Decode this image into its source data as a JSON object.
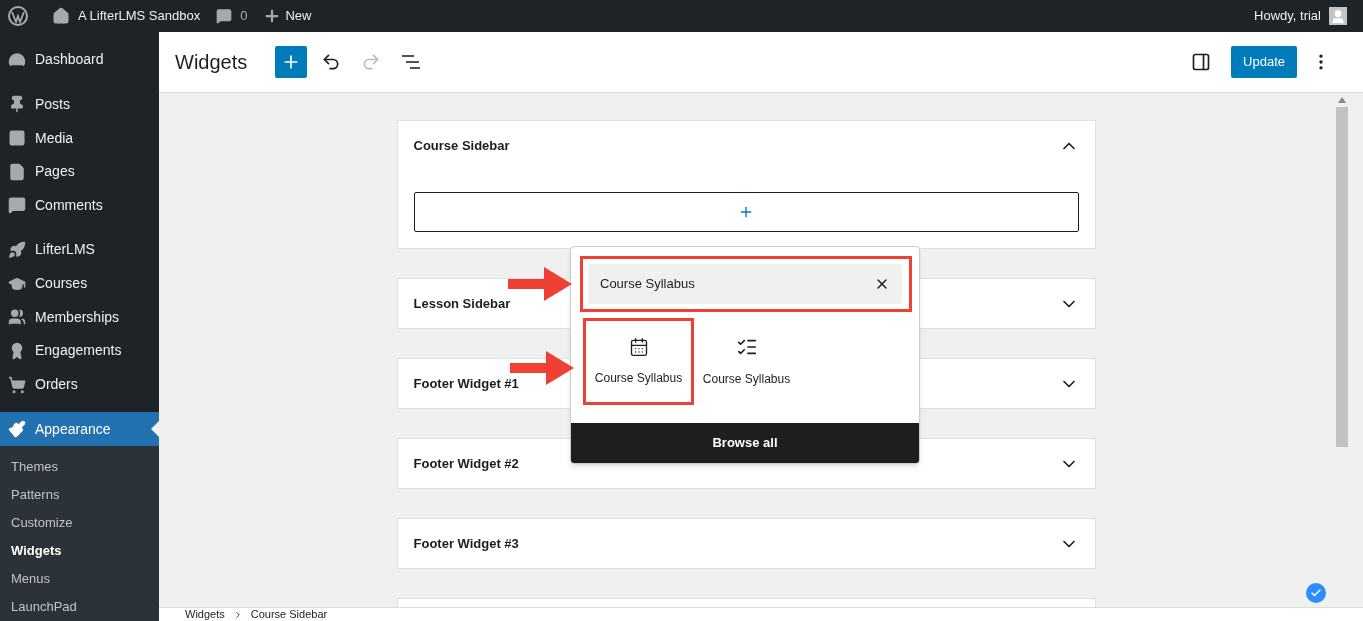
{
  "admin_bar": {
    "site_name": "A LifterLMS Sandbox",
    "comments_count": "0",
    "new_label": "New",
    "greeting": "Howdy, trial"
  },
  "sidebar": {
    "items": [
      {
        "label": "Dashboard",
        "selected": false
      },
      {
        "label": "Posts",
        "selected": false
      },
      {
        "label": "Media",
        "selected": false
      },
      {
        "label": "Pages",
        "selected": false
      },
      {
        "label": "Comments",
        "selected": false
      },
      {
        "label": "LifterLMS",
        "selected": false
      },
      {
        "label": "Courses",
        "selected": false
      },
      {
        "label": "Memberships",
        "selected": false
      },
      {
        "label": "Engagements",
        "selected": false
      },
      {
        "label": "Orders",
        "selected": false
      },
      {
        "label": "Appearance",
        "selected": true
      }
    ],
    "submenu": [
      {
        "label": "Themes",
        "selected": false
      },
      {
        "label": "Patterns",
        "selected": false
      },
      {
        "label": "Customize",
        "selected": false
      },
      {
        "label": "Widgets",
        "selected": true
      },
      {
        "label": "Menus",
        "selected": false
      },
      {
        "label": "LaunchPad",
        "selected": false
      }
    ]
  },
  "header": {
    "title": "Widgets",
    "update_button": "Update"
  },
  "widget_areas": [
    {
      "title": "Course Sidebar",
      "expanded": true
    },
    {
      "title": "Lesson Sidebar",
      "expanded": false
    },
    {
      "title": "Footer Widget #1",
      "expanded": false
    },
    {
      "title": "Footer Widget #2",
      "expanded": false
    },
    {
      "title": "Footer Widget #3",
      "expanded": false
    }
  ],
  "inserter": {
    "search_value": "Course Syllabus",
    "results": [
      {
        "label": "Course Syllabus",
        "kind": "calendar"
      },
      {
        "label": "Course Syllabus",
        "kind": "checklist"
      }
    ],
    "browse_all": "Browse all"
  },
  "breadcrumb": [
    "Widgets",
    "Course Sidebar"
  ]
}
